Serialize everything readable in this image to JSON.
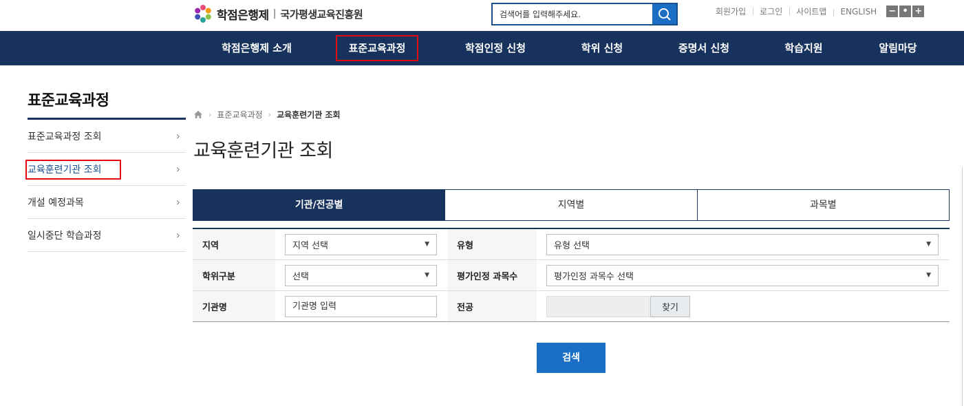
{
  "header": {
    "logo_main": "학점은행제",
    "logo_sep": "|",
    "logo_sub": "국가평생교육진흥원",
    "search_placeholder": "검색어를 입력해주세요.",
    "util_links": [
      "회원가입",
      "로그인",
      "사이트맵",
      "ENGLISH"
    ],
    "zoom": [
      "−",
      "•",
      "+"
    ]
  },
  "gnb": {
    "items": [
      "학점은행제 소개",
      "표준교육과정",
      "학점인정 신청",
      "학위 신청",
      "증명서 신청",
      "학습지원",
      "알림마당"
    ],
    "highlighted_index": 1
  },
  "lnb": {
    "title": "표준교육과정",
    "items": [
      "표준교육과정 조회",
      "교육훈련기관 조회",
      "개설 예정과목",
      "일시중단 학습과정"
    ],
    "active_index": 1
  },
  "breadcrumb": {
    "items": [
      "표준교육과정",
      "교육훈련기관 조회"
    ]
  },
  "page_title": "교육훈련기관 조회",
  "tabs": {
    "items": [
      "기관/전공별",
      "지역별",
      "과목별"
    ],
    "active_index": 0
  },
  "form": {
    "region_label": "지역",
    "region_value": "지역 선택",
    "type_label": "유형",
    "type_value": "유형 선택",
    "degree_label": "학위구분",
    "degree_value": "선택",
    "count_label": "평가인정 과목수",
    "count_value": "평가인정 과목수 선택",
    "org_label": "기관명",
    "org_placeholder": "기관명 입력",
    "major_label": "전공",
    "major_value": "",
    "find_label": "찾기"
  },
  "submit_label": "검색",
  "colors": {
    "navy": "#17325c",
    "blue": "#1a6fc4",
    "highlight_red": "#e30613"
  }
}
